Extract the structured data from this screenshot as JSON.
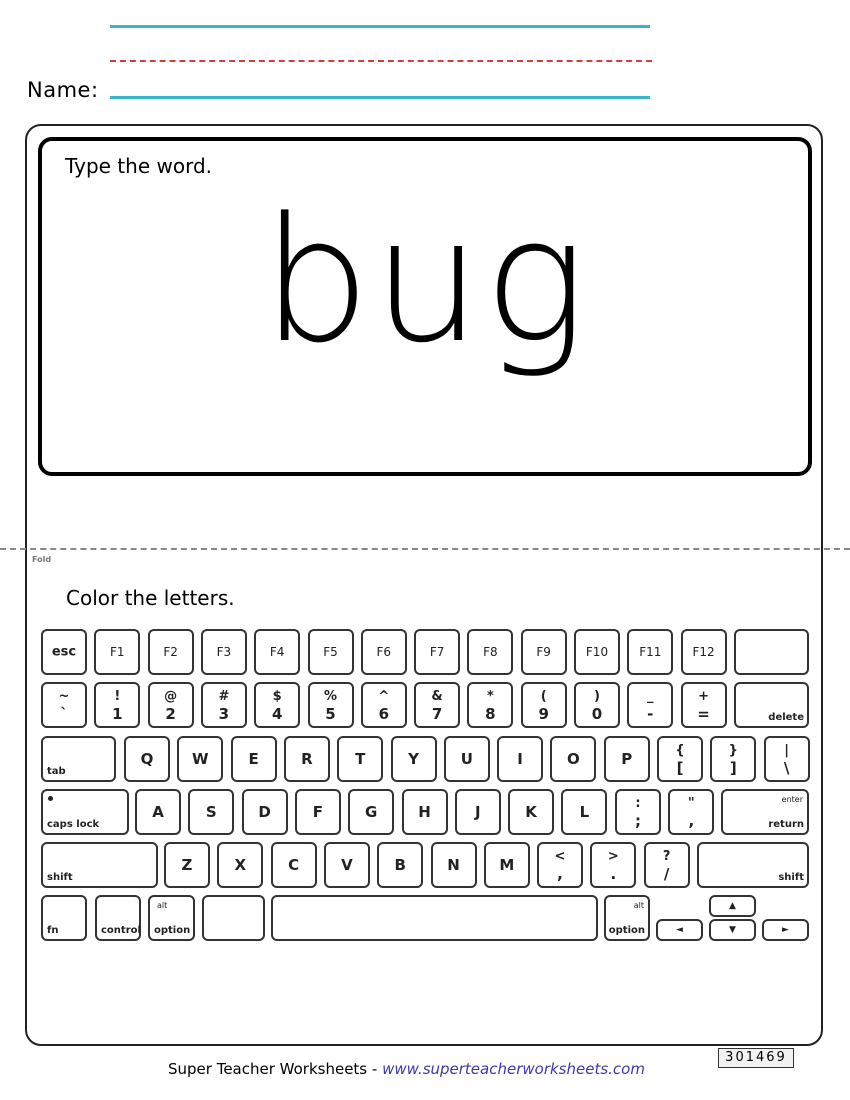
{
  "header": {
    "name_label": "Name:"
  },
  "word_section": {
    "prompt": "Type the word.",
    "word": "bug"
  },
  "fold_label": "Fold",
  "keyboard_section": {
    "prompt": "Color the letters."
  },
  "keyboard": {
    "row1": [
      "esc",
      "F1",
      "F2",
      "F3",
      "F4",
      "F5",
      "F6",
      "F7",
      "F8",
      "F9",
      "F10",
      "F11",
      "F12",
      ""
    ],
    "row2": [
      {
        "top": "~",
        "bot": "`"
      },
      {
        "top": "!",
        "bot": "1"
      },
      {
        "top": "@",
        "bot": "2"
      },
      {
        "top": "#",
        "bot": "3"
      },
      {
        "top": "$",
        "bot": "4"
      },
      {
        "top": "%",
        "bot": "5"
      },
      {
        "top": "^",
        "bot": "6"
      },
      {
        "top": "&",
        "bot": "7"
      },
      {
        "top": "*",
        "bot": "8"
      },
      {
        "top": "(",
        "bot": "9"
      },
      {
        "top": ")",
        "bot": "0"
      },
      {
        "top": "_",
        "bot": "-"
      },
      {
        "top": "+",
        "bot": "="
      }
    ],
    "delete": "delete",
    "tab": "tab",
    "row3": [
      "Q",
      "W",
      "E",
      "R",
      "T",
      "Y",
      "U",
      "I",
      "O",
      "P"
    ],
    "row3_sym": [
      {
        "top": "{",
        "bot": "["
      },
      {
        "top": "}",
        "bot": "]"
      },
      {
        "top": "|",
        "bot": "\\"
      }
    ],
    "caps_lock": "caps lock",
    "row4": [
      "A",
      "S",
      "D",
      "F",
      "G",
      "H",
      "J",
      "K",
      "L"
    ],
    "row4_sym": [
      {
        "top": ":",
        "bot": ";"
      },
      {
        "top": "\"",
        "bot": ","
      }
    ],
    "enter": "enter",
    "return": "return",
    "shift": "shift",
    "row5": [
      "Z",
      "X",
      "C",
      "V",
      "B",
      "N",
      "M"
    ],
    "row5_sym": [
      {
        "top": "<",
        "bot": ","
      },
      {
        "top": ">",
        "bot": "."
      },
      {
        "top": "?",
        "bot": "/"
      }
    ],
    "fn": "fn",
    "control": "control",
    "alt": "alt",
    "option": "option",
    "arrows": {
      "up": "▲",
      "down": "▼",
      "left": "◄",
      "right": "►"
    }
  },
  "footer": {
    "brand": "Super Teacher Worksheets - ",
    "url": "www.superteacherworksheets.com",
    "code": "301469"
  }
}
